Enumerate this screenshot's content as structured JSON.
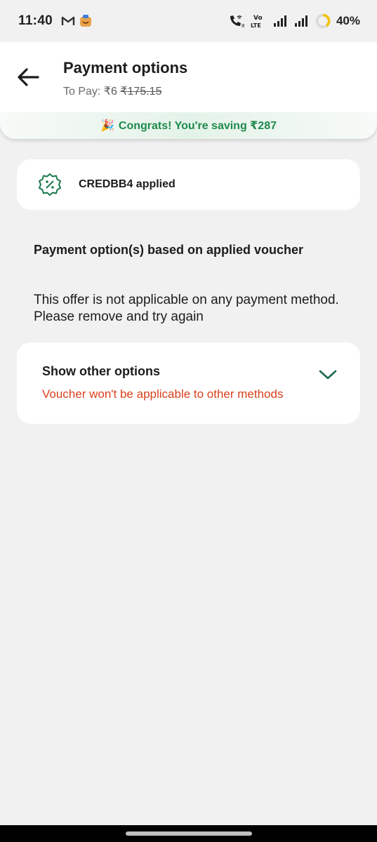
{
  "status_bar": {
    "time": "11:40",
    "battery": "40%",
    "network_label_top": "Vo",
    "network_label_bottom": "LTE",
    "icons": [
      "gmail-icon",
      "shopping-app-icon",
      "wifi-calling-icon",
      "volte-icon",
      "signal-icon",
      "signal-icon",
      "battery-icon"
    ]
  },
  "header": {
    "title": "Payment options",
    "to_pay_label": "To Pay: ",
    "to_pay_amount": "₹6",
    "to_pay_original": "₹175.15"
  },
  "savings_banner": {
    "emoji": "🎉",
    "text": "Congrats! You're saving ₹287"
  },
  "voucher": {
    "label": "CREDBB4 applied",
    "icon": "discount-badge-icon"
  },
  "section": {
    "heading": "Payment option(s) based on applied voucher",
    "info": "This offer is not applicable on any payment method. Please remove and try again"
  },
  "other_options": {
    "title": "Show other options",
    "warning": "Voucher won't be applicable to other methods",
    "icon": "chevron-down-icon"
  },
  "colors": {
    "accent_green": "#1f8a4c",
    "icon_green": "#1b7a4a",
    "warning_red": "#d8401c",
    "background": "#f1f1f1"
  }
}
